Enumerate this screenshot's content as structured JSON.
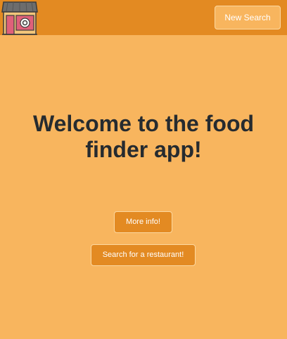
{
  "header": {
    "logo_icon": "storefront-icon",
    "new_search_label": "New Search"
  },
  "main": {
    "title": "Welcome to the food finder app!",
    "more_info_label": "More info!",
    "search_label": "Search for a restaurant!"
  },
  "colors": {
    "background": "#f8b55e",
    "header": "#e38a22",
    "button": "#e38a22",
    "title_text": "#262b2f"
  }
}
